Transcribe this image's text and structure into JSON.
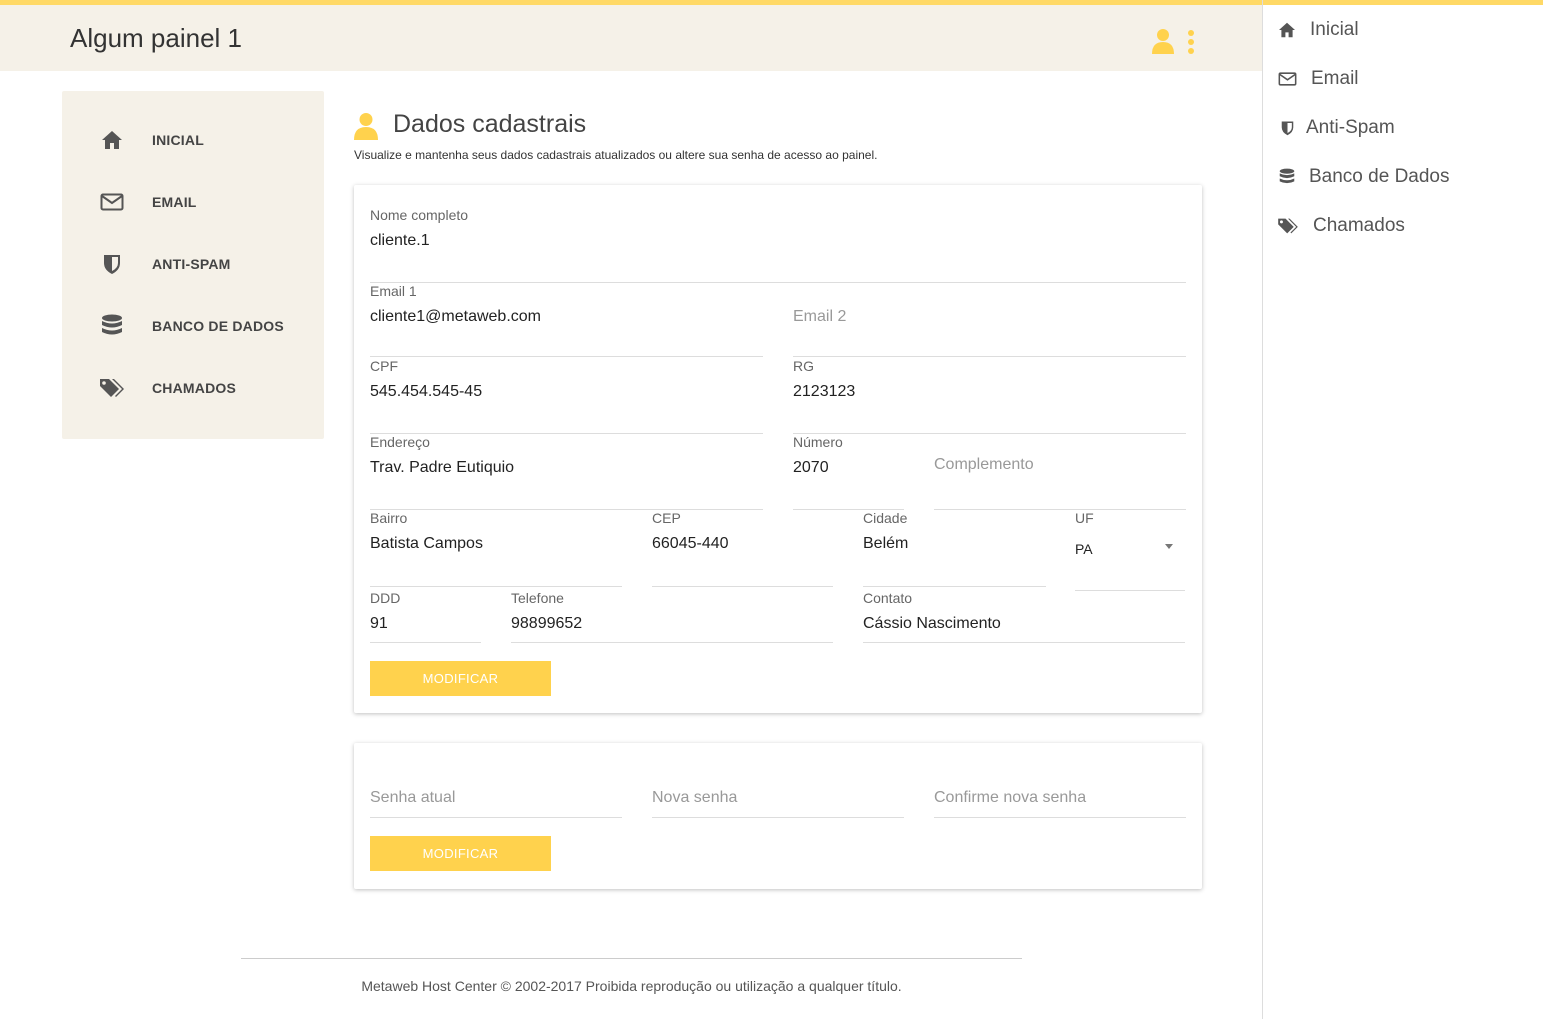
{
  "header": {
    "title": "Algum painel 1"
  },
  "sidebar": {
    "items": [
      {
        "label": "INICIAL"
      },
      {
        "label": "EMAIL"
      },
      {
        "label": "ANTI-SPAM"
      },
      {
        "label": "BANCO DE DADOS"
      },
      {
        "label": "CHAMADOS"
      }
    ]
  },
  "drawer": {
    "items": [
      {
        "label": "Inicial"
      },
      {
        "label": "Email"
      },
      {
        "label": "Anti-Spam"
      },
      {
        "label": "Banco de Dados"
      },
      {
        "label": "Chamados"
      }
    ]
  },
  "page": {
    "title": "Dados cadastrais",
    "subtitle": "Visualize e mantenha seus dados cadastrais atualizados ou altere sua senha de acesso ao painel."
  },
  "form": {
    "nome": {
      "label": "Nome completo",
      "value": "cliente.1"
    },
    "email1": {
      "label": "Email 1",
      "value": "cliente1@metaweb.com"
    },
    "email2": {
      "placeholder": "Email 2"
    },
    "cpf": {
      "label": "CPF",
      "value": "545.454.545-45"
    },
    "rg": {
      "label": "RG",
      "value": "2123123"
    },
    "endereco": {
      "label": "Endereço",
      "value": "Trav. Padre Eutiquio"
    },
    "numero": {
      "label": "Número",
      "value": "2070"
    },
    "complemento": {
      "placeholder": "Complemento"
    },
    "bairro": {
      "label": "Bairro",
      "value": "Batista Campos"
    },
    "cep": {
      "label": "CEP",
      "value": "66045-440"
    },
    "cidade": {
      "label": "Cidade",
      "value": "Belém"
    },
    "uf": {
      "label": "UF",
      "value": "PA"
    },
    "ddd": {
      "label": "DDD",
      "value": "91"
    },
    "telefone": {
      "label": "Telefone",
      "value": "98899652"
    },
    "contato": {
      "label": "Contato",
      "value": "Cássio Nascimento"
    },
    "submit_label": "MODIFICAR"
  },
  "password": {
    "senha_atual": {
      "placeholder": "Senha atual"
    },
    "nova_senha": {
      "placeholder": "Nova senha"
    },
    "confirme": {
      "placeholder": "Confirme nova senha"
    },
    "submit_label": "MODIFICAR"
  },
  "footer": {
    "text": "Metaweb Host Center © 2002-2017 Proibida reprodução ou utilização a qualquer título."
  },
  "colors": {
    "accent": "#ffd24d",
    "panel": "#f5f1e8",
    "icon": "#555555"
  },
  "icons": [
    "home-icon",
    "envelope-icon",
    "shield-icon",
    "database-icon",
    "tags-icon",
    "user-icon",
    "kebab-menu-icon"
  ]
}
